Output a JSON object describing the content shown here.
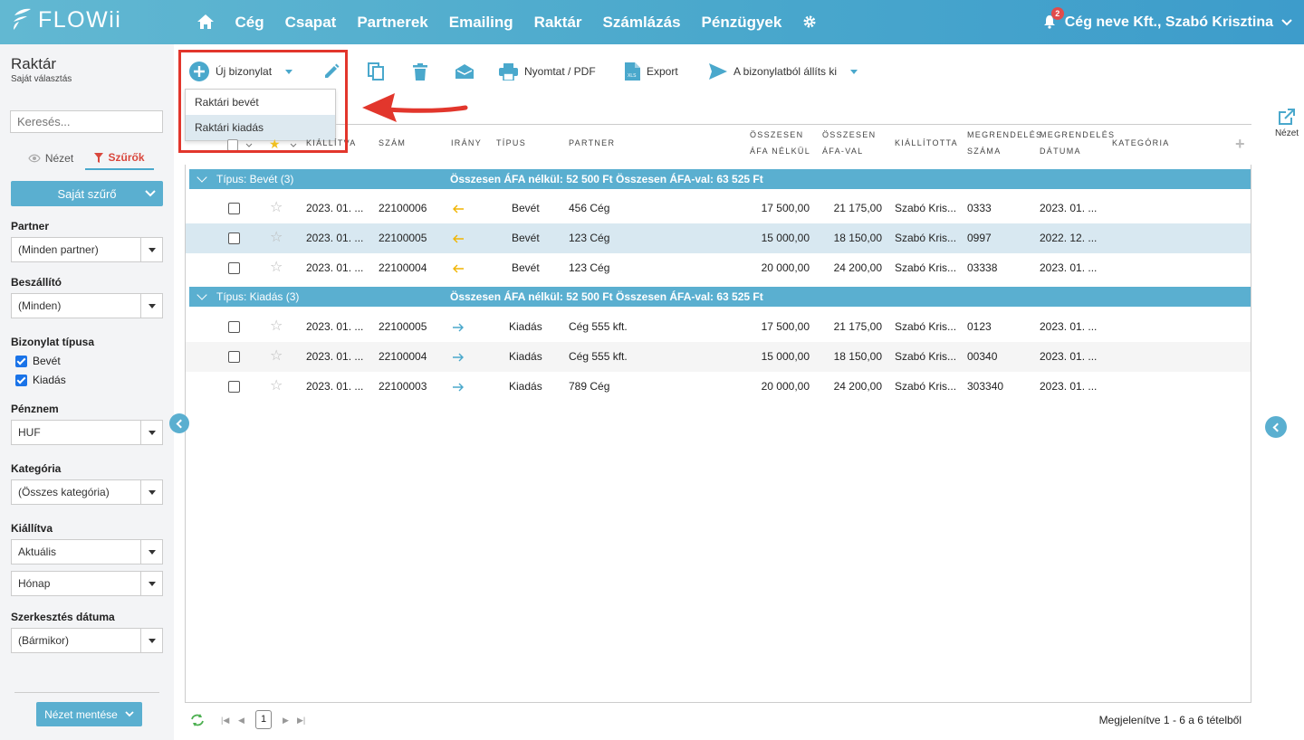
{
  "header": {
    "logo_text": "FLOWii",
    "nav": [
      "Cég",
      "Csapat",
      "Partnerek",
      "Emailing",
      "Raktár",
      "Számlázás",
      "Pénzügyek"
    ],
    "notifications": "2",
    "user": "Cég neve Kft., Szabó Krisztina"
  },
  "sidebar": {
    "title": "Raktár",
    "subtitle": "Saját választás",
    "search_placeholder": "Keresés...",
    "tab_view": "Nézet",
    "tab_filters": "Szűrők",
    "own_filter": "Saját szűrő",
    "partner_label": "Partner",
    "partner_value": "(Minden partner)",
    "supplier_label": "Beszállító",
    "supplier_value": "(Minden)",
    "doctype_label": "Bizonylat típusa",
    "doctype_options": [
      "Bevét",
      "Kiadás"
    ],
    "currency_label": "Pénznem",
    "currency_value": "HUF",
    "category_label": "Kategória",
    "category_value": "(Összes kategória)",
    "issued_label": "Kiállítva",
    "issued_value": "Aktuális",
    "issued_period": "Hónap",
    "edit_date_label": "Szerkesztés dátuma",
    "edit_date_value": "(Bármikor)",
    "save_view": "Nézet mentése"
  },
  "toolbar": {
    "new_doc": "Új bizonylat",
    "print": "Nyomtat / PDF",
    "export": "Export",
    "issue_from": "A bizonylatból állíts ki",
    "dropdown": [
      "Raktári bevét",
      "Raktári kiadás"
    ]
  },
  "columns": {
    "issued": "KIÁLLÍTVA",
    "number": "SZÁM",
    "direction": "IRÁNY",
    "type": "TÍPUS",
    "partner": "PARTNER",
    "net_1": "ÖSSZESEN",
    "net_2": "ÁFA NÉLKÜL",
    "gross_1": "ÖSSZESEN",
    "gross_2": "ÁFA-VAL",
    "issuer": "KIÁLLÍTOTTA",
    "order_no_1": "MEGRENDELÉS",
    "order_no_2": "SZÁMA",
    "order_date_1": "MEGRENDELÉS",
    "order_date_2": "DÁTUMA",
    "category": "KATEGÓRIA"
  },
  "groups": [
    {
      "label": "Típus: Bevét (3)",
      "sum_net": "Összesen ÁFA nélkül: 52 500 Ft",
      "sum_gross": "Összesen ÁFA-val: 63 525 Ft",
      "rows": [
        {
          "date": "2023. 01. ...",
          "number": "22100006",
          "type": "Bevét",
          "partner": "456 Cég",
          "net": "17 500,00",
          "gross": "21 175,00",
          "issuer": "Szabó Kris...",
          "order_no": "0333",
          "order_date": "2023. 01. ..."
        },
        {
          "date": "2023. 01. ...",
          "number": "22100005",
          "type": "Bevét",
          "partner": "123 Cég",
          "net": "15 000,00",
          "gross": "18 150,00",
          "issuer": "Szabó Kris...",
          "order_no": "0997",
          "order_date": "2022. 12. ..."
        },
        {
          "date": "2023. 01. ...",
          "number": "22100004",
          "type": "Bevét",
          "partner": "123 Cég",
          "net": "20 000,00",
          "gross": "24 200,00",
          "issuer": "Szabó Kris...",
          "order_no": "03338",
          "order_date": "2023. 01. ..."
        }
      ]
    },
    {
      "label": "Típus: Kiadás (3)",
      "sum_net": "Összesen ÁFA nélkül: 52 500 Ft",
      "sum_gross": "Összesen ÁFA-val: 63 525 Ft",
      "rows": [
        {
          "date": "2023. 01. ...",
          "number": "22100005",
          "type": "Kiadás",
          "partner": "Cég 555 kft.",
          "net": "17 500,00",
          "gross": "21 175,00",
          "issuer": "Szabó Kris...",
          "order_no": "0123",
          "order_date": "2023. 01. ..."
        },
        {
          "date": "2023. 01. ...",
          "number": "22100004",
          "type": "Kiadás",
          "partner": "Cég 555 kft.",
          "net": "15 000,00",
          "gross": "18 150,00",
          "issuer": "Szabó Kris...",
          "order_no": "00340",
          "order_date": "2023. 01. ..."
        },
        {
          "date": "2023. 01. ...",
          "number": "22100003",
          "type": "Kiadás",
          "partner": "789 Cég",
          "net": "20 000,00",
          "gross": "24 200,00",
          "issuer": "Szabó Kris...",
          "order_no": "303340",
          "order_date": "2023. 01. ..."
        }
      ]
    }
  ],
  "footer": {
    "page": "1",
    "info": "Megjelenítve 1 - 6 a 6 tételből"
  },
  "right_rail": {
    "view_label": "Nézet"
  },
  "colors": {
    "brand": "#4aa8cc",
    "highlight": "#e2362c",
    "incoming_arrow": "#f0b400",
    "outgoing_arrow": "#4aa8cc"
  }
}
